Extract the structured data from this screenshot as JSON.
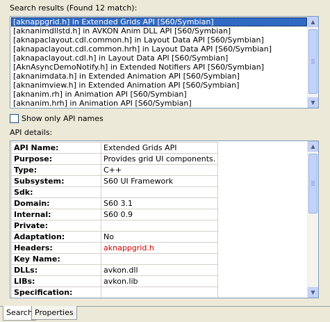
{
  "search": {
    "results_label": "Search results (Found 12 match):",
    "results": [
      "[aknappgrid.h] in Extended Grids API   [S60/Symbian]",
      "[aknanimdllstd.h] in AVKON Anim DLL API   [S60/Symbian]",
      "[aknapaclayout.cdl.common.h] in Layout Data API   [S60/Symbian]",
      "[aknapaclayout.cdl.common.hrh] in Layout Data API   [S60/Symbian]",
      "[aknapaclayout.cdl.h] in Layout Data API   [S60/Symbian]",
      "[AknAsyncDemoNotify.h] in Extended Notifiers API   [S60/Symbian]",
      "[aknanimdata.h] in Extended Animation API   [S60/Symbian]",
      "[aknanimview.h] in Extended Animation API   [S60/Symbian]",
      "[aknanim.rh] in Animation API   [S60/Symbian]",
      "[aknanim.hrh] in Animation API   [S60/Symbian]"
    ],
    "selected_index": 0,
    "show_only_api_names_label": "Show only API names",
    "show_only_api_names_checked": false
  },
  "details": {
    "label": "API details:",
    "rows": [
      {
        "key": "API Name:",
        "value": "Extended Grids API"
      },
      {
        "key": "Purpose:",
        "value": "Provides grid UI components."
      },
      {
        "key": "Type:",
        "value": "C++"
      },
      {
        "key": "Subsystem:",
        "value": "S60 UI Framework"
      },
      {
        "key": "Sdk:",
        "value": ""
      },
      {
        "key": "Domain:",
        "value": "S60 3.1"
      },
      {
        "key": "Internal:",
        "value": "S60 0.9"
      },
      {
        "key": "Private:",
        "value": ""
      },
      {
        "key": "Adaptation:",
        "value": "No"
      },
      {
        "key": "Headers:",
        "value": "aknappgrid.h",
        "link": true
      },
      {
        "key": "Key Name:",
        "value": ""
      },
      {
        "key": "DLLs:",
        "value": "avkon.dll"
      },
      {
        "key": "LIBs:",
        "value": "avkon.lib"
      },
      {
        "key": "Specification:",
        "value": ""
      }
    ]
  },
  "tabs": [
    {
      "label": "Search",
      "active": true
    },
    {
      "label": "Properties",
      "active": false
    }
  ],
  "colors": {
    "selection": "#316ac5",
    "link": "#cc0000",
    "window_bg": "#ece9d8"
  },
  "icons": [
    "scroll-up-icon",
    "scroll-down-icon"
  ]
}
